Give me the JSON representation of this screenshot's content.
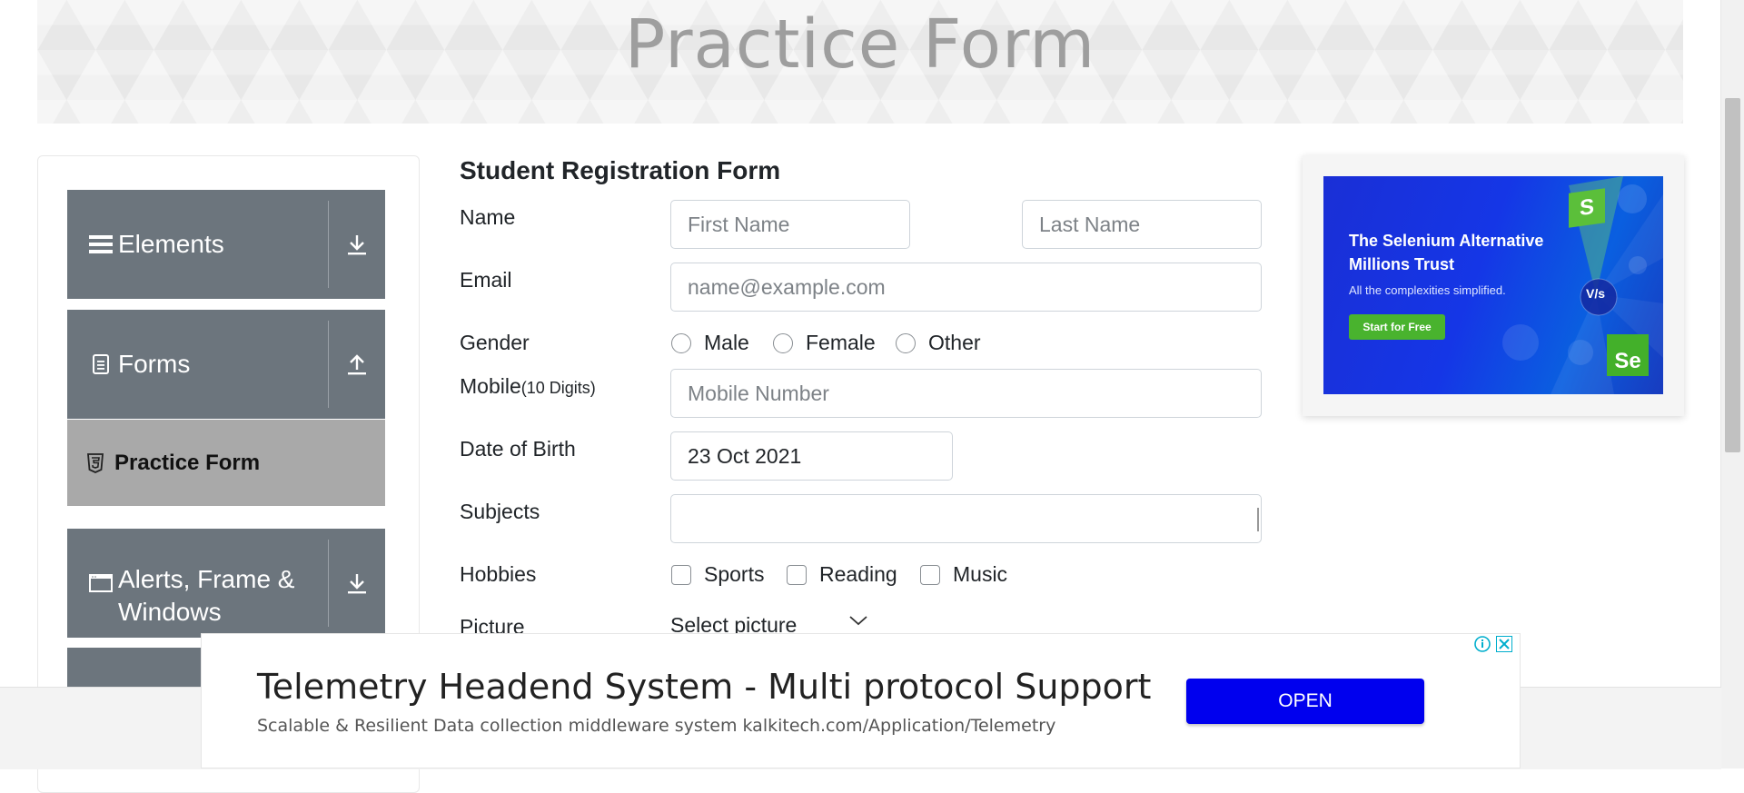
{
  "banner": {
    "title": "Practice Form"
  },
  "sidebar": {
    "groups": [
      {
        "label": "Elements",
        "icon": "hamburger-icon",
        "toggle_icon": "download-arrow-icon"
      },
      {
        "label": "Forms",
        "icon": "document-icon",
        "toggle_icon": "upload-arrow-icon"
      },
      {
        "label": "Alerts, Frame & Windows",
        "icon": "window-icon",
        "toggle_icon": "download-arrow-icon"
      }
    ],
    "active_item": {
      "label": "Practice Form",
      "icon": "html5-icon"
    }
  },
  "form": {
    "title": "Student Registration Form",
    "name": {
      "label": "Name",
      "first_placeholder": "First Name",
      "last_placeholder": "Last Name"
    },
    "email": {
      "label": "Email",
      "placeholder": "name@example.com"
    },
    "gender": {
      "label": "Gender",
      "options": [
        "Male",
        "Female",
        "Other"
      ]
    },
    "mobile": {
      "label": "Mobile",
      "hint": "(10 Digits)",
      "placeholder": "Mobile Number"
    },
    "dob": {
      "label": "Date of Birth",
      "value": "23 Oct 2021"
    },
    "subjects": {
      "label": "Subjects",
      "value": ""
    },
    "hobbies": {
      "label": "Hobbies",
      "options": [
        "Sports",
        "Reading",
        "Music"
      ]
    },
    "picture": {
      "label": "Picture",
      "button": "Select picture"
    }
  },
  "side_ad": {
    "headline_1": "The Selenium Alternative",
    "headline_2": "Millions Trust",
    "subtext": "All the complexities simplified.",
    "cta": "Start for Free",
    "vs": "V/s",
    "logo_s": "S",
    "logo_se": "Se",
    "colors": {
      "background": "#1536e6",
      "cta": "#49b32e"
    }
  },
  "bottom_ad": {
    "title": "Telemetry Headend System - Multi protocol Support",
    "description": "Scalable & Resilient Data collection middleware system kalkitech.com/Application/Telemetry",
    "cta": "OPEN",
    "colors": {
      "cta": "#0000ee"
    }
  },
  "colors": {
    "sidebar_group": "#6c757d",
    "sidebar_active": "#a9a9a9"
  }
}
